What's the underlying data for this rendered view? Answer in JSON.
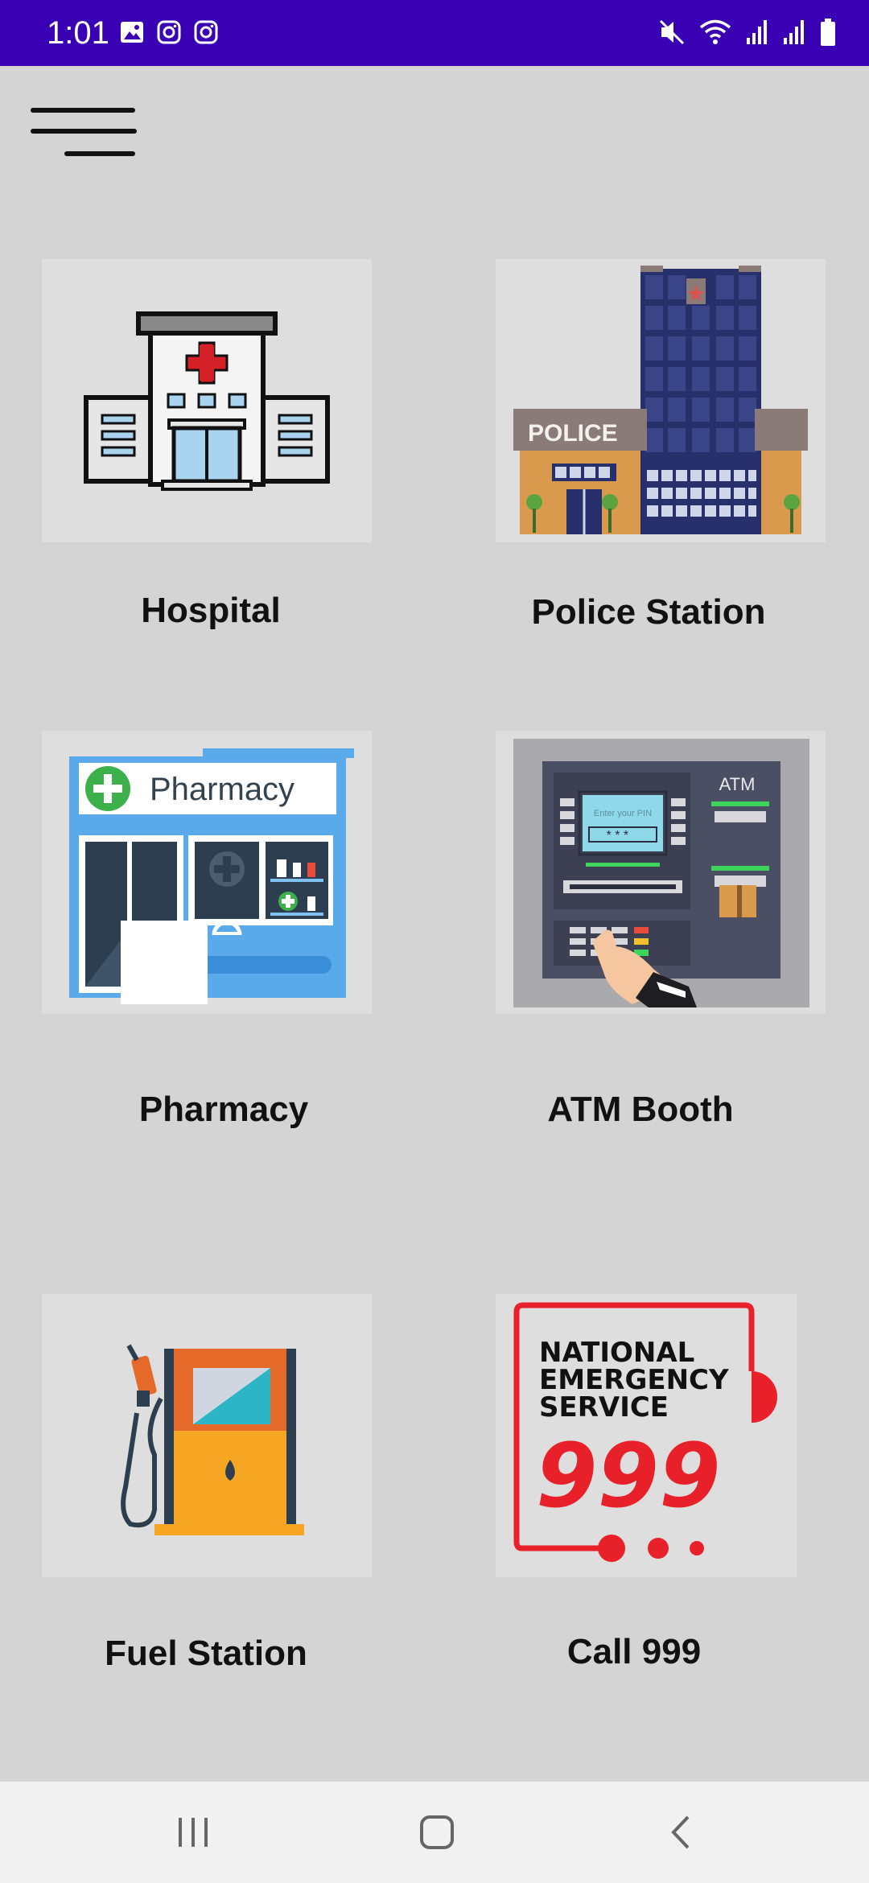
{
  "status_bar": {
    "time": "1:01",
    "left_icons": [
      "gallery-icon",
      "instagram-icon",
      "instagram-icon"
    ],
    "right_icons": [
      "mute-icon",
      "wifi-icon",
      "signal-icon",
      "signal-icon",
      "battery-icon"
    ],
    "color": "#3a00b3"
  },
  "menu": {
    "icon": "hamburger-menu-icon"
  },
  "tiles": [
    {
      "label": "Hospital",
      "icon": "hospital-icon"
    },
    {
      "label": "Police Station",
      "icon": "police-station-icon"
    },
    {
      "label": "Pharmacy",
      "icon": "pharmacy-icon",
      "sign_text": "Pharmacy"
    },
    {
      "label": "ATM Booth",
      "icon": "atm-icon",
      "sign_text": "ATM",
      "screen_text": "Enter your PIN",
      "pin_text": "* * * _"
    },
    {
      "label": "Fuel Station",
      "icon": "fuel-pump-icon"
    },
    {
      "label": "Call 999",
      "icon": "emergency-999-icon",
      "line1": "NATIONAL",
      "line2": "EMERGENCY",
      "line3": "SERVICE",
      "number": "999"
    }
  ],
  "police_sign": "POLICE",
  "nav_bar": {
    "buttons": [
      "recent-apps-icon",
      "home-icon",
      "back-icon"
    ]
  }
}
